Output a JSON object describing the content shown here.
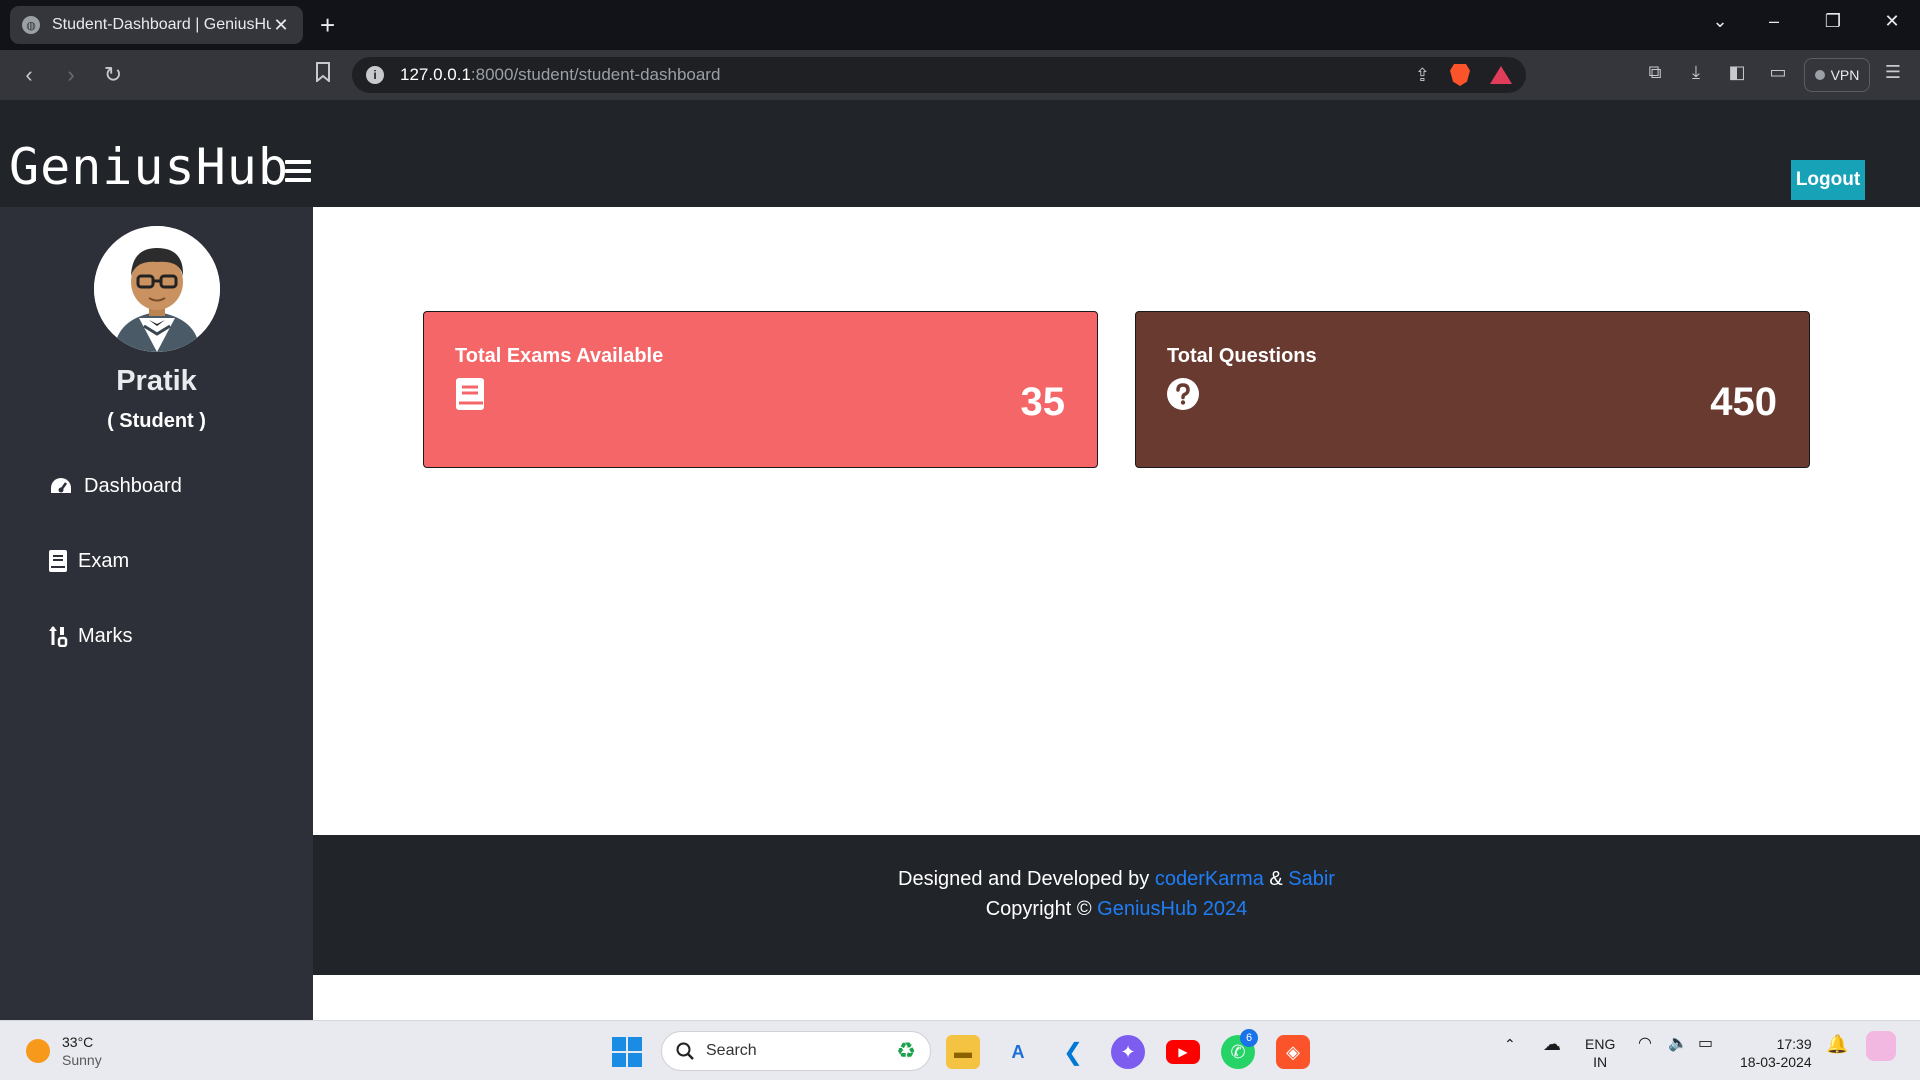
{
  "browser": {
    "tab_title": "Student-Dashboard | GeniusHub",
    "tab_close": "✕",
    "new_tab": "+",
    "url_host": "127.0.0.1",
    "url_path": ":8000/student/student-dashboard",
    "vpn_label": "VPN"
  },
  "app": {
    "brand": "GeniusHub",
    "logout_label": "Logout"
  },
  "sidebar": {
    "user_name": "Pratik",
    "user_role": "( Student )",
    "items": [
      {
        "label": "Dashboard",
        "icon": "tachometer-icon"
      },
      {
        "label": "Exam",
        "icon": "book-icon"
      },
      {
        "label": "Marks",
        "icon": "sort-numeric-icon"
      }
    ]
  },
  "cards": [
    {
      "label": "Total Exams Available",
      "value": "35",
      "icon": "book-icon",
      "color": "#f46667"
    },
    {
      "label": "Total Questions",
      "value": "450",
      "icon": "question-circle-icon",
      "color": "#693a30"
    }
  ],
  "footer": {
    "designed_prefix": "Designed and Developed by",
    "author1": "coderKarma",
    "amp": "&",
    "author2": "Sabir",
    "copyright_prefix": "Copyright ©",
    "copyright_link": "GeniusHub 2024"
  },
  "taskbar": {
    "temperature": "33°C",
    "condition": "Sunny",
    "search_placeholder": "Search",
    "lang_line1": "ENG",
    "lang_line2": "IN",
    "time": "17:39",
    "date": "18-03-2024",
    "whatsapp_badge": "6"
  },
  "colors": {
    "header_bg": "#212529",
    "sidebar_bg": "#2d3039",
    "logout_bg": "#17a2b8",
    "link": "#1f7df5"
  }
}
